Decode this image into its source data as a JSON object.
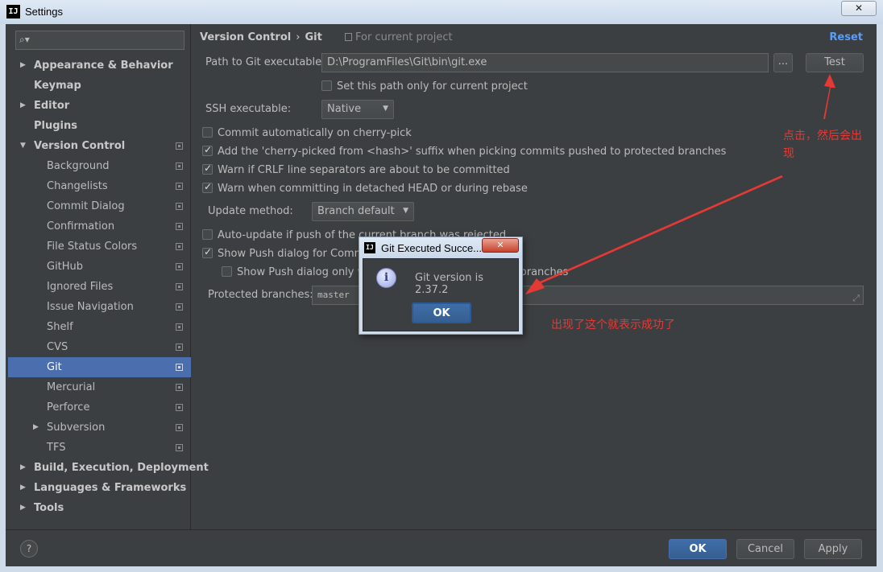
{
  "window": {
    "title": "Settings",
    "app_icon_text": "IJ",
    "close_glyph": "✕"
  },
  "sidebar": {
    "search_glyph": "⌕▾",
    "items": [
      {
        "label": "Appearance & Behavior",
        "bold": true,
        "level": 0,
        "arrow": "▶"
      },
      {
        "label": "Keymap",
        "bold": true,
        "level": 0,
        "arrow": ""
      },
      {
        "label": "Editor",
        "bold": true,
        "level": 0,
        "arrow": "▶"
      },
      {
        "label": "Plugins",
        "bold": true,
        "level": 0,
        "arrow": ""
      },
      {
        "label": "Version Control",
        "bold": true,
        "level": 0,
        "arrow": "▼",
        "proj": true
      },
      {
        "label": "Background",
        "level": 1,
        "proj": true
      },
      {
        "label": "Changelists",
        "level": 1,
        "proj": true
      },
      {
        "label": "Commit Dialog",
        "level": 1,
        "proj": true
      },
      {
        "label": "Confirmation",
        "level": 1,
        "proj": true
      },
      {
        "label": "File Status Colors",
        "level": 1,
        "proj": true
      },
      {
        "label": "GitHub",
        "level": 1,
        "proj": true
      },
      {
        "label": "Ignored Files",
        "level": 1,
        "proj": true
      },
      {
        "label": "Issue Navigation",
        "level": 1,
        "proj": true
      },
      {
        "label": "Shelf",
        "level": 1,
        "proj": true
      },
      {
        "label": "CVS",
        "level": 1,
        "proj": true
      },
      {
        "label": "Git",
        "level": 1,
        "proj": true,
        "selected": true
      },
      {
        "label": "Mercurial",
        "level": 1,
        "proj": true
      },
      {
        "label": "Perforce",
        "level": 1,
        "proj": true
      },
      {
        "label": "Subversion",
        "level": 1,
        "proj": true,
        "arrow": "▶"
      },
      {
        "label": "TFS",
        "level": 1,
        "proj": true
      },
      {
        "label": "Build, Execution, Deployment",
        "bold": true,
        "level": 0,
        "arrow": "▶"
      },
      {
        "label": "Languages & Frameworks",
        "bold": true,
        "level": 0,
        "arrow": "▶"
      },
      {
        "label": "Tools",
        "bold": true,
        "level": 0,
        "arrow": "▶"
      }
    ]
  },
  "header": {
    "crumb_parent": "Version Control",
    "crumb_sep": "›",
    "crumb_current": "Git",
    "for_project": "For current project",
    "reset": "Reset"
  },
  "git": {
    "path_label": "Path to Git executable:",
    "path_value": "D:\\ProgramFiles\\Git\\bin\\git.exe",
    "browse": "...",
    "test": "Test",
    "set_path_only": "Set this path only for current project",
    "ssh_label": "SSH executable:",
    "ssh_value": "Native",
    "checks": [
      {
        "label": "Commit automatically on cherry-pick",
        "checked": false
      },
      {
        "label": "Add the 'cherry-picked from <hash>' suffix when picking commits pushed to protected branches",
        "checked": true
      },
      {
        "label": "Warn if CRLF line separators are about to be committed",
        "checked": true
      },
      {
        "label": "Warn when committing in detached HEAD or during rebase",
        "checked": true
      }
    ],
    "update_label": "Update method:",
    "update_value": "Branch default",
    "auto_update": "Auto-update if push of the current branch was rejected",
    "show_push": "Show Push dialog for Commit and Push",
    "show_push_only": "Show Push dialog only when committing to protected branches",
    "protected_label": "Protected branches:",
    "protected_value": "master",
    "expand_glyph": "⤢"
  },
  "footer": {
    "help": "?",
    "ok": "OK",
    "cancel": "Cancel",
    "apply": "Apply"
  },
  "dialog": {
    "title": "Git Executed Succe...",
    "close": "✕",
    "icon": "i",
    "message": "Git version is 2.37.2",
    "ok": "OK"
  },
  "annotations": {
    "click_note": "点击，然后会出现",
    "success_note": "出现了这个就表示成功了",
    "color": "#e53935"
  }
}
